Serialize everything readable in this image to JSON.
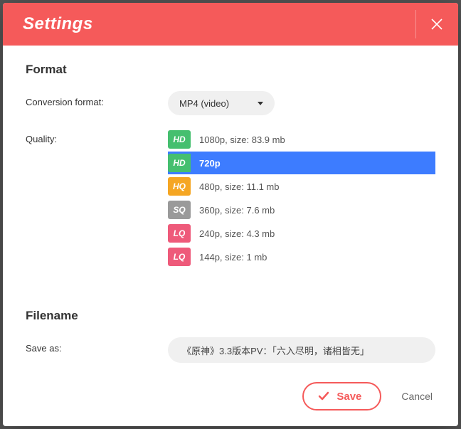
{
  "title": "Settings",
  "sections": {
    "format": {
      "heading": "Format",
      "conversion_label": "Conversion format:",
      "conversion_value": "MP4 (video)",
      "quality_label": "Quality:",
      "quality_options": [
        {
          "badge": "HD",
          "color": "#45bf6f",
          "label": "1080p, size: 83.9 mb",
          "selected": false
        },
        {
          "badge": "HD",
          "color": "#45bf6f",
          "label": "720p",
          "selected": true
        },
        {
          "badge": "HQ",
          "color": "#f5a623",
          "label": "480p, size: 11.1 mb",
          "selected": false
        },
        {
          "badge": "SQ",
          "color": "#9a9a9a",
          "label": "360p, size: 7.6 mb",
          "selected": false
        },
        {
          "badge": "LQ",
          "color": "#ee5a7a",
          "label": "240p, size: 4.3 mb",
          "selected": false
        },
        {
          "badge": "LQ",
          "color": "#ee5a7a",
          "label": "144p, size: 1 mb",
          "selected": false
        }
      ]
    },
    "filename": {
      "heading": "Filename",
      "saveas_label": "Save as:",
      "saveas_value": "《原神》3.3版本PV：「六入尽明，诸相皆无」"
    }
  },
  "footer": {
    "save": "Save",
    "cancel": "Cancel"
  }
}
